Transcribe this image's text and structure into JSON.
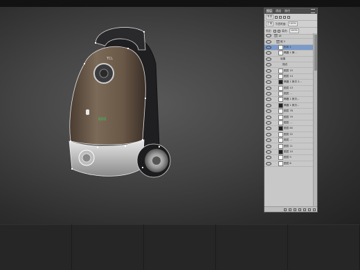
{
  "panel": {
    "tabs": [
      "图层",
      "通道",
      "路径"
    ],
    "active_tab": 0,
    "kind_filter": "类型",
    "blend_mode": "正常",
    "opacity_label": "不透明度:",
    "opacity_value": "100%",
    "lock_label": "锁定:",
    "fill_label": "填充:",
    "fill_value": "100%",
    "layers": [
      {
        "name": "18",
        "indent": 1,
        "kind": "folder"
      },
      {
        "name": "组 2",
        "indent": 2,
        "kind": "folder"
      },
      {
        "name": "形状 1",
        "indent": 3,
        "kind": "shape",
        "selected": true
      },
      {
        "name": "椭圆 1 拷...",
        "indent": 3,
        "kind": "layer"
      },
      {
        "name": "效果",
        "indent": 4,
        "kind": "fx"
      },
      {
        "name": "描边",
        "indent": 5,
        "kind": "fx"
      },
      {
        "name": "图层 15",
        "indent": 3,
        "kind": "layer"
      },
      {
        "name": "图层 14",
        "indent": 3,
        "kind": "layer"
      },
      {
        "name": "椭圆 1 拷贝 2...",
        "indent": 3,
        "kind": "layer"
      },
      {
        "name": "图层 13",
        "indent": 3,
        "kind": "layer"
      },
      {
        "name": "图层 ...",
        "indent": 3,
        "kind": "layer"
      },
      {
        "name": "椭圆 1 拷贝...",
        "indent": 3,
        "kind": "layer"
      },
      {
        "name": "椭圆 1 拷贝...",
        "indent": 3,
        "kind": "layer"
      },
      {
        "name": "图层 78",
        "indent": 3,
        "kind": "layer"
      },
      {
        "name": "图层 79",
        "indent": 3,
        "kind": "layer"
      },
      {
        "name": "图层 ...",
        "indent": 3,
        "kind": "layer"
      },
      {
        "name": "图层 80",
        "indent": 3,
        "kind": "layer"
      },
      {
        "name": "图层 22",
        "indent": 3,
        "kind": "layer"
      },
      {
        "name": "图层 ...",
        "indent": 3,
        "kind": "layer"
      },
      {
        "name": "图层 11",
        "indent": 3,
        "kind": "layer"
      },
      {
        "name": "图层 10",
        "indent": 3,
        "kind": "layer"
      },
      {
        "name": "图层 9",
        "indent": 3,
        "kind": "layer"
      },
      {
        "name": "图层 8",
        "indent": 3,
        "kind": "layer"
      }
    ]
  },
  "product": {
    "brand": "TCL",
    "display": "600"
  },
  "colors": {
    "body": "#6b5a4a",
    "panel_bg": "#c8c8c8",
    "selection": "#7a9ac9"
  }
}
